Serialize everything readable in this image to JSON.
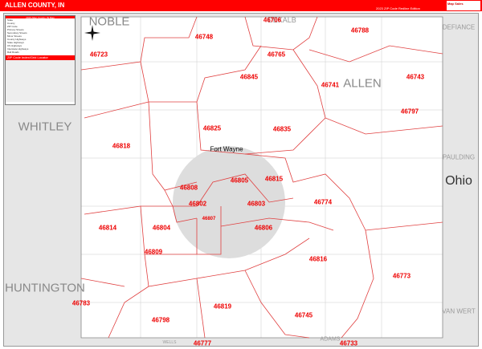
{
  "header": {
    "title": "ALLEN COUNTY, IN",
    "edition": "2023 ZIP Code Redline Edition",
    "logo": "Map Sales"
  },
  "legend": {
    "title": "2023 Allen County, IN Map",
    "items": [
      "State",
      "County",
      "ZIP Code",
      "Primary Streets",
      "Secondary Streets",
      "Minor Streets",
      "County Highways",
      "State Highways",
      "US Highways",
      "Interstate Highways",
      "Rail Roads"
    ],
    "index_title": "ZIP Code Index/Grid Locator"
  },
  "map": {
    "city": "Fort Wayne",
    "neighbors": [
      "NOBLE",
      "DEKALB",
      "DEFIANCE",
      "ALLEN",
      "WHITLEY",
      "PAULDING",
      "HUNTINGTON",
      "VAN WERT",
      "ADAMS",
      "WELLS"
    ],
    "state": "Ohio",
    "zips": [
      "46706",
      "46748",
      "46788",
      "46723",
      "46765",
      "46845",
      "46741",
      "46743",
      "46797",
      "46825",
      "46835",
      "46818",
      "46815",
      "46805",
      "46808",
      "46802",
      "46803",
      "46774",
      "46807",
      "46806",
      "46814",
      "46804",
      "46809",
      "46816",
      "46773",
      "46783",
      "46819",
      "46745",
      "46798",
      "46777",
      "46733"
    ]
  },
  "colors": {
    "brand": "#ff0000",
    "zip_label": "#ee0000",
    "boundary": "#e04040"
  }
}
